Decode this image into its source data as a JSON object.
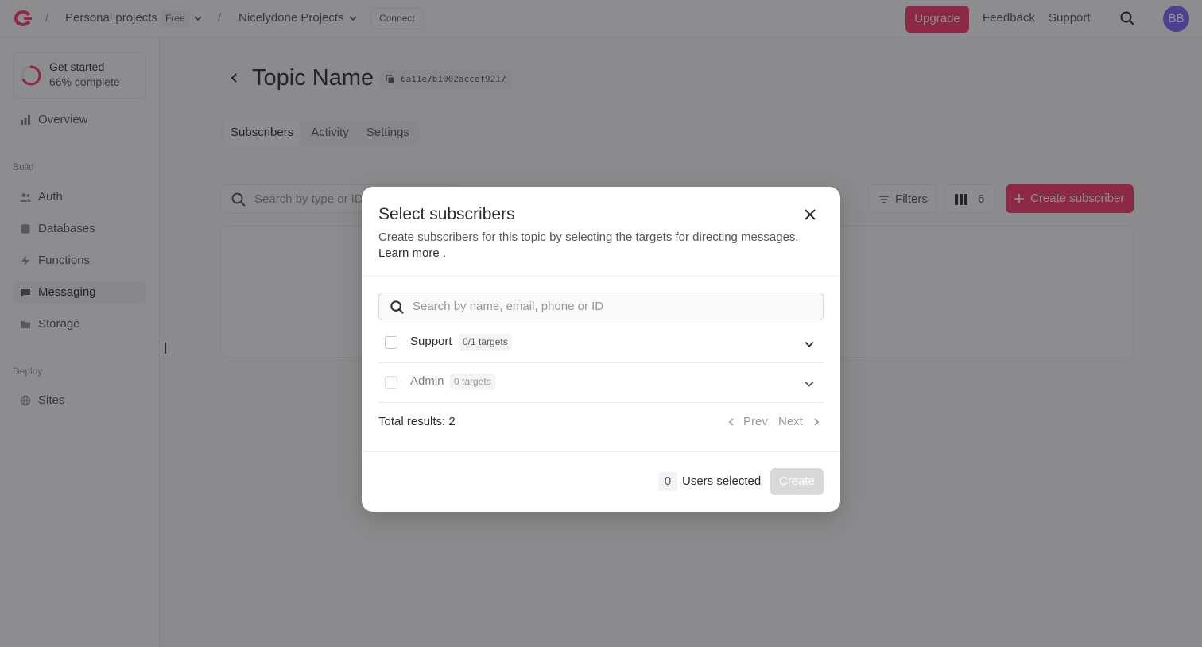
{
  "header": {
    "org": "Personal projects",
    "plan_badge": "Free",
    "project": "Nicelydone Projects",
    "connect": "Connect",
    "upgrade": "Upgrade",
    "feedback": "Feedback",
    "support": "Support",
    "avatar_initials": "BB",
    "separator": "/"
  },
  "sidebar": {
    "get_started": {
      "title": "Get started",
      "progress_text": "66% complete",
      "progress": 0.66
    },
    "overview": "Overview",
    "build_label": "Build",
    "build_items": [
      {
        "label": "Auth",
        "icon": "users-icon"
      },
      {
        "label": "Databases",
        "icon": "database-icon"
      },
      {
        "label": "Functions",
        "icon": "lightning-icon"
      },
      {
        "label": "Messaging",
        "icon": "chat-icon",
        "active": true
      },
      {
        "label": "Storage",
        "icon": "folder-icon"
      }
    ],
    "deploy_label": "Deploy",
    "deploy_items": [
      {
        "label": "Sites",
        "icon": "globe-icon"
      }
    ]
  },
  "page": {
    "title": "Topic Name",
    "topic_id": "6a11e7b1002accef9217",
    "tabs": [
      "Subscribers",
      "Activity",
      "Settings"
    ],
    "active_tab": "Subscribers",
    "search_placeholder": "Search by type or IDs",
    "filters": "Filters",
    "columns_count": "6",
    "create_subscriber": "Create subscriber"
  },
  "modal": {
    "title": "Select subscribers",
    "description": "Create subscribers for this topic by selecting the targets for directing messages.",
    "learn_more": "Learn more",
    "learn_more_suffix": ".",
    "search_placeholder": "Search by name, email, phone or ID",
    "rows": [
      {
        "name": "Support",
        "targets": "0/1 targets"
      },
      {
        "name": "Admin",
        "targets": "0 targets"
      }
    ],
    "total_results": "Total results: 2",
    "prev": "Prev",
    "next": "Next",
    "selected_count": "0",
    "selected_label": "Users selected",
    "create": "Create"
  },
  "colors": {
    "accent": "#fd366e",
    "avatar": "#7c67fe",
    "overlay": "rgba(28,28,32,0.5)"
  }
}
